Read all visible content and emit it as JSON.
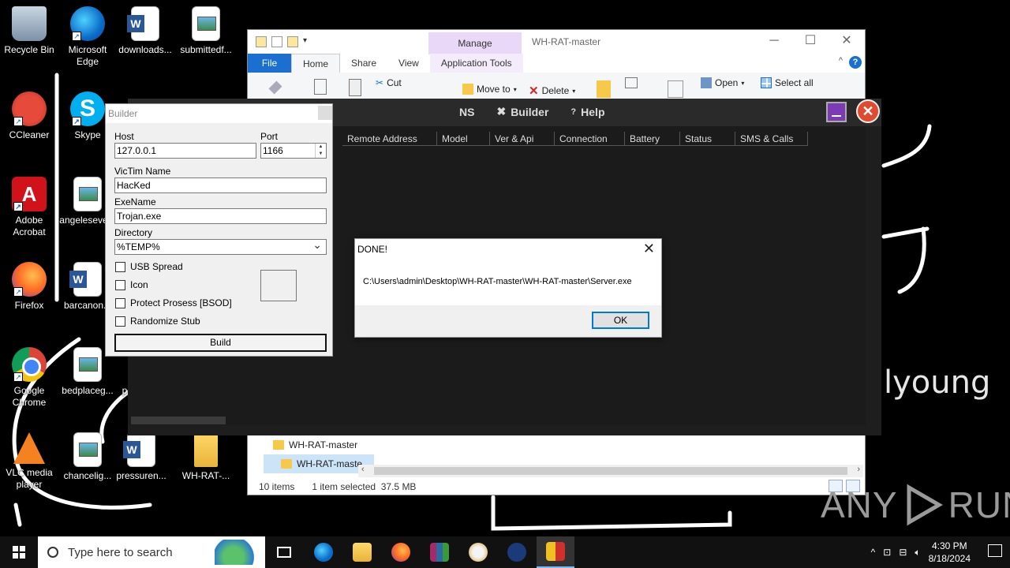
{
  "desktop": {
    "icons": [
      {
        "label": "Recycle Bin",
        "label2": ""
      },
      {
        "label": "Microsoft",
        "label2": "Edge"
      },
      {
        "label": "downloads...",
        "label2": ""
      },
      {
        "label": "submittedf...",
        "label2": ""
      },
      {
        "label": "CCleaner",
        "label2": ""
      },
      {
        "label": "Skype",
        "label2": ""
      },
      {
        "label": "Adobe",
        "label2": "Acrobat"
      },
      {
        "label": "angeleseve...",
        "label2": ""
      },
      {
        "label": "Firefox",
        "label2": ""
      },
      {
        "label": "barcanon...",
        "label2": ""
      },
      {
        "label": "Google",
        "label2": "Chrome"
      },
      {
        "label": "bedplaceg...",
        "label2": ""
      },
      {
        "label": "p",
        "label2": ""
      },
      {
        "label": "VLC media",
        "label2": "player"
      },
      {
        "label": "chancelig...",
        "label2": ""
      },
      {
        "label": "pressuren...",
        "label2": ""
      },
      {
        "label": "WH-RAT-...",
        "label2": ""
      }
    ],
    "scrawl_text": "lyoung"
  },
  "explorer": {
    "title": "WH-RAT-master",
    "manage_tab": "Manage",
    "tabs": [
      "File",
      "Home",
      "Share",
      "View",
      "Application Tools"
    ],
    "ribbon": {
      "cut": "Cut",
      "move_to": "Move to",
      "delete": "Delete",
      "open": "Open",
      "select_all": "Select all"
    },
    "nav": [
      "WH-RAT-master",
      "WH-RAT-maste"
    ],
    "status": {
      "items": "10 items",
      "selected": "1 item selected",
      "size": "37.5 MB"
    }
  },
  "rat": {
    "menu": [
      "NS",
      "Builder",
      "Help"
    ],
    "columns": [
      "Remote Address",
      "Model",
      "Ver & Api",
      "Connection",
      "Battery",
      "Status",
      "SMS & Calls"
    ]
  },
  "builder": {
    "title": "Builder",
    "host_label": "Host",
    "host_value": "127.0.0.1",
    "port_label": "Port",
    "port_value": "1166",
    "victim_label": "VicTim Name",
    "victim_value": "HacKed",
    "exe_label": "ExeName",
    "exe_value": "Trojan.exe",
    "dir_label": "Directory",
    "dir_value": "%TEMP%",
    "checks": [
      "USB Spread",
      "Icon",
      "Protect Prosess [BSOD]",
      "Randomize Stub"
    ],
    "build_label": "Build"
  },
  "dialog": {
    "title": "DONE!",
    "message": "C:\\Users\\admin\\Desktop\\WH-RAT-master\\WH-RAT-master\\Server.exe",
    "ok": "OK"
  },
  "watermark": {
    "left": "ANY",
    "right": "RUN"
  },
  "taskbar": {
    "search_placeholder": "Type here to search",
    "time": "4:30 PM",
    "date": "8/18/2024"
  }
}
